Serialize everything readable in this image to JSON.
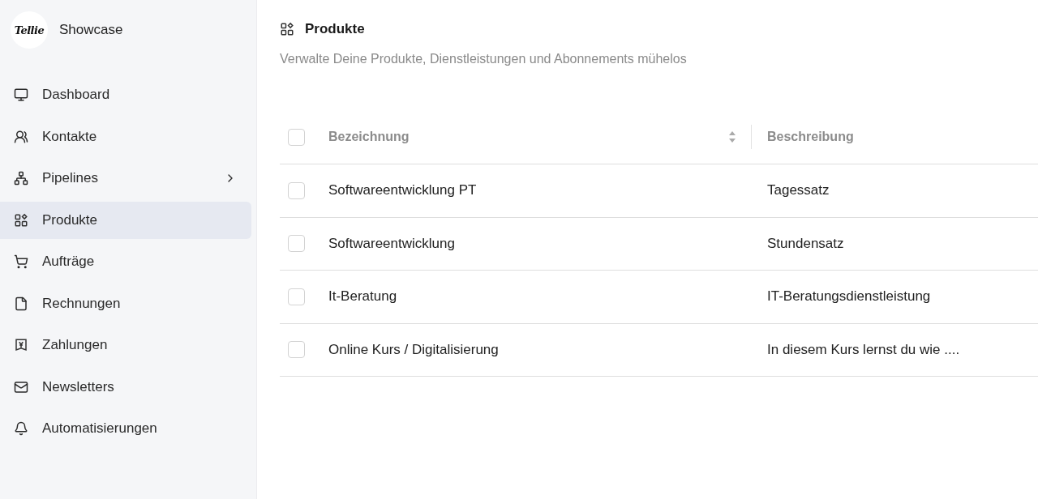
{
  "sidebar": {
    "logo": "Tellie",
    "workspace": "Showcase",
    "items": [
      {
        "label": "Dashboard",
        "selected": false,
        "has_children": false
      },
      {
        "label": "Kontakte",
        "selected": false,
        "has_children": false
      },
      {
        "label": "Pipelines",
        "selected": false,
        "has_children": true
      },
      {
        "label": "Produkte",
        "selected": true,
        "has_children": false
      },
      {
        "label": "Aufträge",
        "selected": false,
        "has_children": false
      },
      {
        "label": "Rechnungen",
        "selected": false,
        "has_children": false
      },
      {
        "label": "Zahlungen",
        "selected": false,
        "has_children": false
      },
      {
        "label": "Newsletters",
        "selected": false,
        "has_children": false
      },
      {
        "label": "Automatisierungen",
        "selected": false,
        "has_children": false
      }
    ]
  },
  "page": {
    "title": "Produkte",
    "subtitle": "Verwalte Deine Produkte, Dienstleistungen und Abonnements mühelos"
  },
  "table": {
    "select_all_checked": false,
    "columns": [
      {
        "label": "Bezeichnung",
        "sortable": true
      },
      {
        "label": "Beschreibung",
        "sortable": false
      }
    ],
    "rows": [
      {
        "checked": false,
        "cells": [
          "Softwareentwicklung PT",
          "Tagessatz"
        ]
      },
      {
        "checked": false,
        "cells": [
          "Softwareentwicklung",
          "Stundensatz"
        ]
      },
      {
        "checked": false,
        "cells": [
          "It-Beratung",
          "IT-Beratungsdienstleistung"
        ]
      },
      {
        "checked": false,
        "cells": [
          "Online Kurs / Digitalisierung",
          "In diesem Kurs lernst du wie ...."
        ]
      }
    ]
  }
}
